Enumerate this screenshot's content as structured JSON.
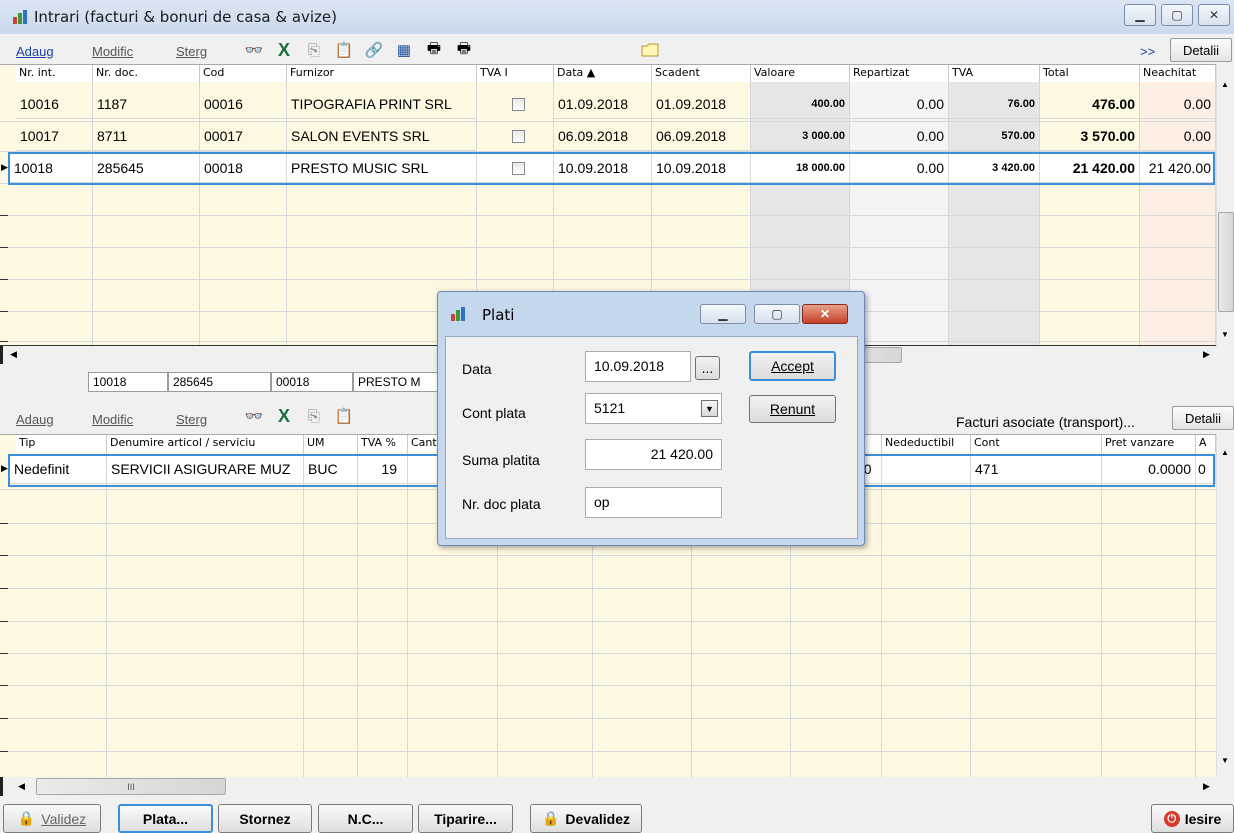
{
  "window": {
    "title": "Intrari (facturi & bonuri de casa & avize)"
  },
  "top_toolbar": {
    "add": "Adaug",
    "modify": "Modific",
    "delete": "Sterg",
    "more": ">>",
    "details": "Detalii"
  },
  "top_grid": {
    "columns": [
      "Nr. int.",
      "Nr. doc.",
      "Cod",
      "Furnizor",
      "TVA I",
      "Data ▲",
      "Scadent",
      "Valoare",
      "Repartizat",
      "TVA",
      "Total",
      "Neachitat"
    ],
    "rows": [
      {
        "nr_int": "10016",
        "nr_doc": "1187",
        "cod": "00016",
        "furnizor": "TIPOGRAFIA PRINT SRL",
        "data": "01.09.2018",
        "scadent": "01.09.2018",
        "valoare": "400.00",
        "repartizat": "0.00",
        "tva": "76.00",
        "total": "476.00",
        "neachitat": "0.00"
      },
      {
        "nr_int": "10017",
        "nr_doc": "8711",
        "cod": "00017",
        "furnizor": "SALON EVENTS SRL",
        "data": "06.09.2018",
        "scadent": "06.09.2018",
        "valoare": "3 000.00",
        "repartizat": "0.00",
        "tva": "570.00",
        "total": "3 570.00",
        "neachitat": "0.00"
      },
      {
        "nr_int": "10018",
        "nr_doc": "285645",
        "cod": "00018",
        "furnizor": "PRESTO MUSIC SRL",
        "data": "10.09.2018",
        "scadent": "10.09.2018",
        "valoare": "18 000.00",
        "repartizat": "0.00",
        "tva": "3 420.00",
        "total": "21 420.00",
        "neachitat": "21 420.00"
      }
    ]
  },
  "info_bar": {
    "nr_int": "10018",
    "nr_doc": "285645",
    "cod": "00018",
    "furnizor": "PRESTO M"
  },
  "bottom_toolbar": {
    "add": "Adaug",
    "modify": "Modific",
    "delete": "Sterg",
    "associated": "Facturi asociate (transport)...",
    "details": "Detalii"
  },
  "bottom_grid": {
    "columns_left": [
      "Tip",
      "Denumire articol / serviciu",
      "UM",
      "TVA %",
      "Cant"
    ],
    "columns_right": [
      "Nedeductibil",
      "Cont",
      "Pret vanzare",
      "A"
    ],
    "row": {
      "tip": "Nedefinit",
      "denumire": "SERVICII ASIGURARE MUZ",
      "um": "BUC",
      "tva": "19",
      "partial": "00",
      "cont": "471",
      "pret": "0.0000",
      "extra": "0"
    }
  },
  "scroll_marker": "III",
  "dialog": {
    "title": "Plati",
    "date_label": "Data",
    "date_value": "10.09.2018",
    "date_btn": "...",
    "account_label": "Cont plata",
    "account_value": "5121",
    "amount_label": "Suma platita",
    "amount_value": "21 420.00",
    "docnr_label": "Nr. doc plata",
    "docnr_value": "op",
    "accept": "Accept",
    "cancel": "Renunt"
  },
  "bottom_bar": {
    "validate": "Validez",
    "pay": "Plata...",
    "reverse": "Stornez",
    "nc": "N.C...",
    "print": "Tiparire...",
    "invalidate": "Devalidez",
    "exit": "Iesire"
  }
}
